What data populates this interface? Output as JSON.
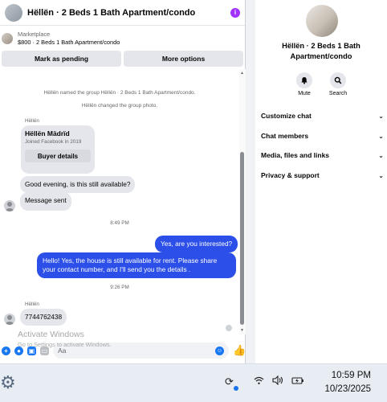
{
  "chat_header": {
    "title": "Hëllën · 2 Beds 1 Bath Apartment/condo",
    "info_icon": "i"
  },
  "listing": {
    "label": "Marketplace",
    "detail": "$800 · 2 Beds 1 Bath Apartment/condo",
    "buttons": {
      "pending": "Mark as pending",
      "more": "More options"
    }
  },
  "messages": {
    "system1": "Hëllën named the group Hëllën · 2 Beds 1 Bath Apartment/condo.",
    "system2": "Hëllën changed the group photo.",
    "sender_label_1": "Hëllën",
    "card": {
      "name": "Hëllën Mädrïd",
      "joined": "Joined Facebook in 2019",
      "button": "Buyer details"
    },
    "in1": "Good evening, is this still available?",
    "in2": "Message sent",
    "time1": "8:49 PM",
    "out1": "Yes, are you interested?",
    "out2": "Hello! Yes, the house is still available for rent. Please share your contact number, and I'll send you the details .",
    "time2": "9:26 PM",
    "sender_label_2": "Hëllën",
    "in3": "7744762438"
  },
  "composer": {
    "placeholder": "Aa"
  },
  "info": {
    "title": "Hëllën · 2 Beds 1 Bath Apartment/condo",
    "actions": [
      {
        "label": "Mute",
        "icon": "bell-icon"
      },
      {
        "label": "Search",
        "icon": "search-icon"
      }
    ],
    "sections": [
      "Customize chat",
      "Chat members",
      "Media, files and links",
      "Privacy & support"
    ]
  },
  "watermark": {
    "title": "Activate Windows",
    "subtitle": "Go to Settings to activate Windows."
  },
  "taskbar": {
    "time": "10:59 PM",
    "date": "10/23/2025"
  },
  "colors": {
    "accent": "#2b4fe8",
    "messenger_blue": "#1877f2",
    "info_purple": "#a033ff"
  }
}
